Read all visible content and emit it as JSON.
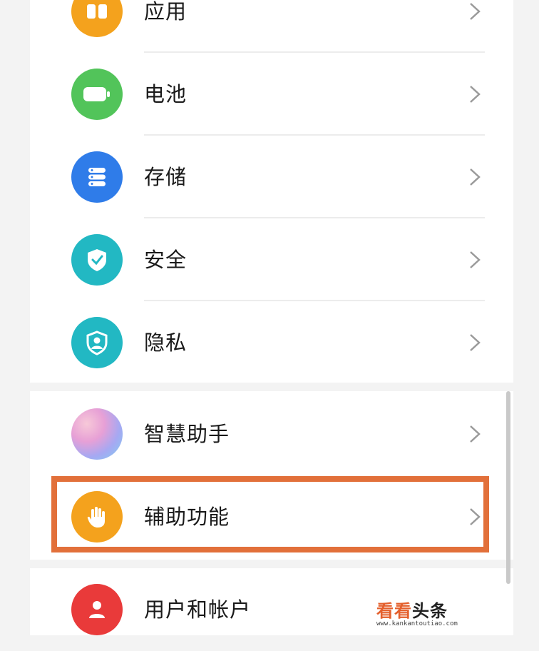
{
  "settings": {
    "items": [
      {
        "label": "应用",
        "icon": "apps-icon",
        "color": "#f4a21d"
      },
      {
        "label": "电池",
        "icon": "battery-icon",
        "color": "#52c45a"
      },
      {
        "label": "存储",
        "icon": "storage-icon",
        "color": "#2f7ce9"
      },
      {
        "label": "安全",
        "icon": "shield-check-icon",
        "color": "#22b8c3"
      },
      {
        "label": "隐私",
        "icon": "privacy-icon",
        "color": "#22b8c3"
      },
      {
        "label": "智慧助手",
        "icon": "smart-assistant-icon",
        "color": "#b9a2e8"
      },
      {
        "label": "辅助功能",
        "icon": "hand-icon",
        "color": "#f4a21d"
      },
      {
        "label": "用户和帐户",
        "icon": "user-icon",
        "color": "#e93a3a"
      }
    ],
    "highlighted_item": "辅助功能"
  },
  "watermark": {
    "brand": "看看",
    "brand_suffix": "头条",
    "url": "www.kankantoutiao.com"
  },
  "colors": {
    "highlight_border": "#e2703a",
    "background": "#f3f3f3",
    "panel": "#ffffff"
  }
}
